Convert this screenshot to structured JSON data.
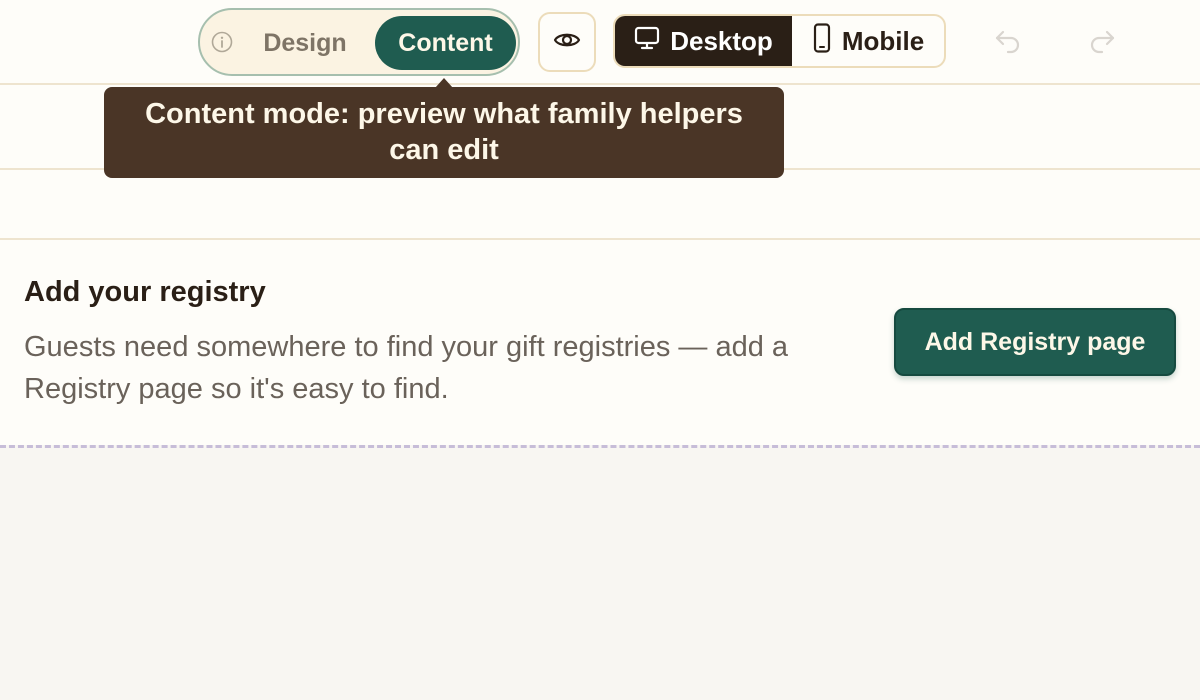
{
  "toolbar": {
    "mode_toggle": {
      "info_icon": "info-circle-icon",
      "design_label": "Design",
      "content_label": "Content",
      "active": "Content"
    },
    "preview_icon": "eye-icon",
    "device_toggle": {
      "desktop_label": "Desktop",
      "desktop_icon": "monitor-icon",
      "mobile_label": "Mobile",
      "mobile_icon": "phone-icon",
      "active": "Desktop"
    },
    "undo_icon": "undo-icon",
    "redo_icon": "redo-icon"
  },
  "tooltip": {
    "text": "Content mode: preview what family helpers can edit"
  },
  "registry_prompt": {
    "title": "Add your registry",
    "description": "Guests need somewhere to find your gift registries — add a Registry page so it's easy to find.",
    "button_label": "Add Registry page"
  },
  "colors": {
    "accent": "#1f5c50",
    "dark": "#2a1f16",
    "tooltip_bg": "#4a3526",
    "panel_bg": "#fefdf9",
    "page_bg": "#f8f6f2",
    "divider": "#c7bdd8"
  }
}
